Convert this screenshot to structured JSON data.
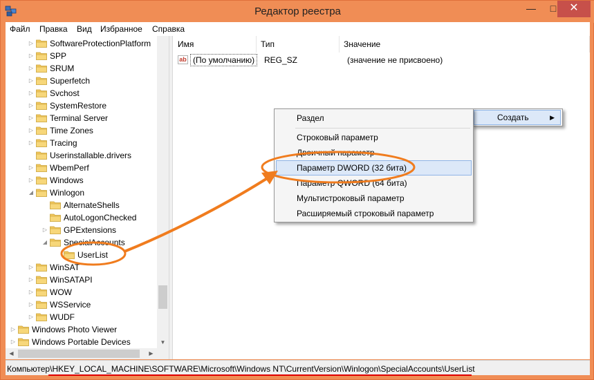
{
  "window": {
    "title": "Редактор реестра",
    "minimize_glyph": "—",
    "maximize_glyph": "□",
    "close_glyph": "✕"
  },
  "menu": [
    "Файл",
    "Правка",
    "Вид",
    "Избранное",
    "Справка"
  ],
  "tree": [
    {
      "label": "SoftwareProtectionPlatform",
      "expander": "▷",
      "level": 1
    },
    {
      "label": "SPP",
      "expander": "▷",
      "level": 1
    },
    {
      "label": "SRUM",
      "expander": "▷",
      "level": 1
    },
    {
      "label": "Superfetch",
      "expander": "▷",
      "level": 1
    },
    {
      "label": "Svchost",
      "expander": "▷",
      "level": 1
    },
    {
      "label": "SystemRestore",
      "expander": "▷",
      "level": 1
    },
    {
      "label": "Terminal Server",
      "expander": "▷",
      "level": 1
    },
    {
      "label": "Time Zones",
      "expander": "▷",
      "level": 1
    },
    {
      "label": "Tracing",
      "expander": "▷",
      "level": 1
    },
    {
      "label": "Userinstallable.drivers",
      "expander": "",
      "level": 1
    },
    {
      "label": "WbemPerf",
      "expander": "▷",
      "level": 1
    },
    {
      "label": "Windows",
      "expander": "▷",
      "level": 1
    },
    {
      "label": "Winlogon",
      "expander": "◢",
      "level": 1
    },
    {
      "label": "AlternateShells",
      "expander": "",
      "level": 2
    },
    {
      "label": "AutoLogonChecked",
      "expander": "",
      "level": 2
    },
    {
      "label": "GPExtensions",
      "expander": "▷",
      "level": 2
    },
    {
      "label": "SpecialAccounts",
      "expander": "◢",
      "level": 2
    },
    {
      "label": "UserList",
      "expander": "",
      "level": 3
    },
    {
      "label": "WinSAT",
      "expander": "▷",
      "level": 1
    },
    {
      "label": "WinSATAPI",
      "expander": "▷",
      "level": 1
    },
    {
      "label": "WOW",
      "expander": "▷",
      "level": 1
    },
    {
      "label": "WSService",
      "expander": "▷",
      "level": 1
    },
    {
      "label": "WUDF",
      "expander": "▷",
      "level": 1
    },
    {
      "label": "Windows Photo Viewer",
      "expander": "▷",
      "level": 0
    },
    {
      "label": "Windows Portable Devices",
      "expander": "▷",
      "level": 0
    }
  ],
  "columns": {
    "name": "Имя",
    "type": "Тип",
    "data": "Значение"
  },
  "values": [
    {
      "icon": "ab",
      "name": "(По умолчанию)",
      "type": "REG_SZ",
      "data": "(значение не присвоено)"
    }
  ],
  "context_menu": {
    "create": "Создать",
    "items": [
      "Раздел",
      "Строковый параметр",
      "Двоичный параметр",
      "Параметр DWORD (32 бита)",
      "Параметр QWORD (64 бита)",
      "Мультистроковый параметр",
      "Расширяемый строковый параметр"
    ]
  },
  "status": {
    "path": "Компьютер\\HKEY_LOCAL_MACHINE\\SOFTWARE\\Microsoft\\Windows NT\\CurrentVersion\\Winlogon\\SpecialAccounts\\UserList"
  },
  "colors": {
    "titlebar": "#f08d55",
    "annotation_orange": "#f07c1e",
    "highlight": "#dce8f8",
    "underline_red": "#e00000"
  }
}
